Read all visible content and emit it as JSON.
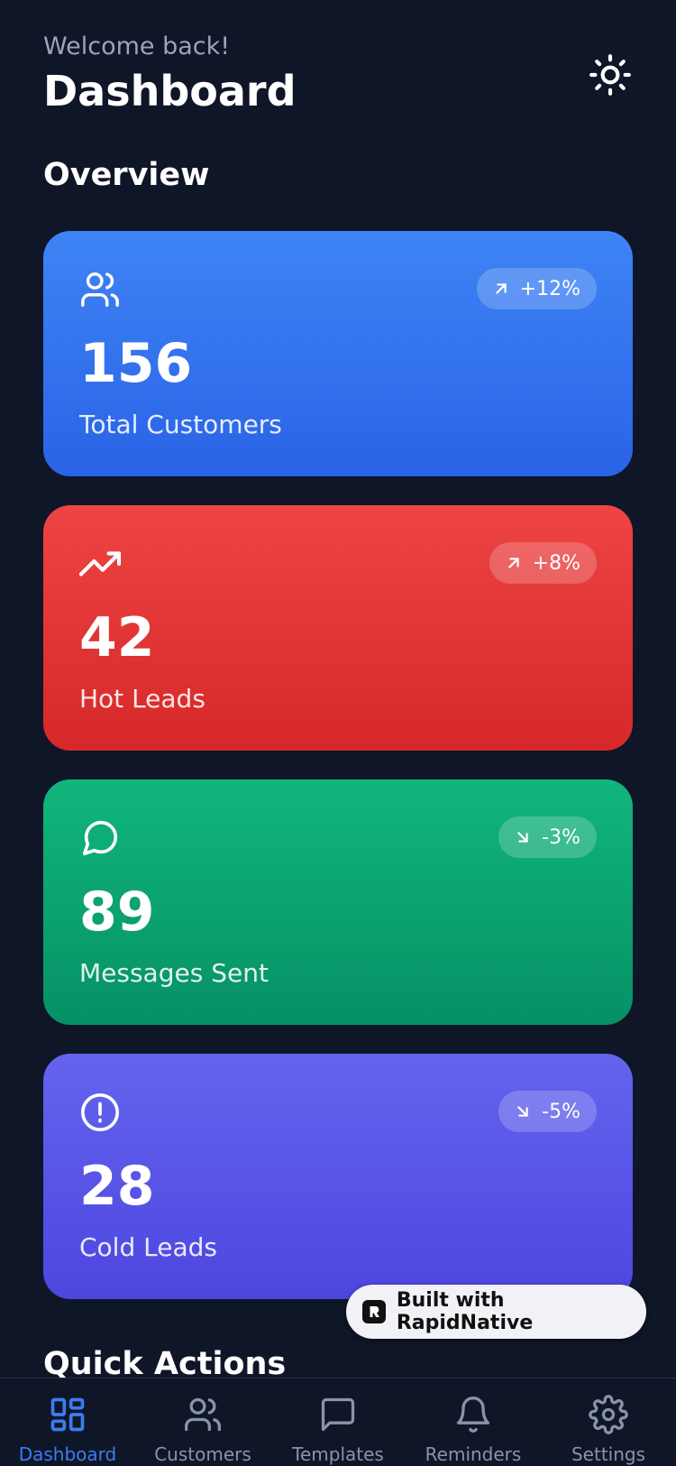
{
  "header": {
    "welcome": "Welcome back!",
    "title": "Dashboard",
    "theme_icon": "sun-icon"
  },
  "overview": {
    "title": "Overview",
    "cards": [
      {
        "icon": "users-icon",
        "value": "156",
        "label": "Total Customers",
        "trend": "+12%",
        "trend_dir": "up",
        "color": "#3b82f6"
      },
      {
        "icon": "trending-up-icon",
        "value": "42",
        "label": "Hot Leads",
        "trend": "+8%",
        "trend_dir": "up",
        "color": "#ef4444"
      },
      {
        "icon": "message-circle-icon",
        "value": "89",
        "label": "Messages Sent",
        "trend": "-3%",
        "trend_dir": "down",
        "color": "#10b981"
      },
      {
        "icon": "alert-circle-icon",
        "value": "28",
        "label": "Cold Leads",
        "trend": "-5%",
        "trend_dir": "down",
        "color": "#6366f1"
      }
    ]
  },
  "quick_actions": {
    "title": "Quick Actions"
  },
  "built_with": {
    "label": "Built with RapidNative"
  },
  "tabbar": {
    "items": [
      {
        "label": "Dashboard",
        "icon": "grid-icon",
        "active": true
      },
      {
        "label": "Customers",
        "icon": "users-icon",
        "active": false
      },
      {
        "label": "Templates",
        "icon": "message-square-icon",
        "active": false
      },
      {
        "label": "Reminders",
        "icon": "bell-icon",
        "active": false
      },
      {
        "label": "Settings",
        "icon": "settings-icon",
        "active": false
      }
    ],
    "active_color": "#3b7df0"
  }
}
